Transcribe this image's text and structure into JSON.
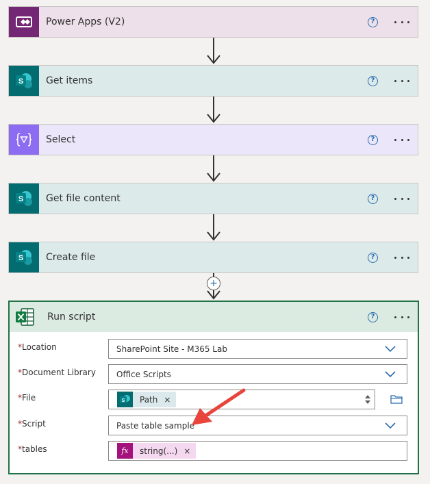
{
  "steps": [
    {
      "title": "Power Apps (V2)",
      "help": "?"
    },
    {
      "title": "Get items",
      "help": "?"
    },
    {
      "title": "Select",
      "help": "?"
    },
    {
      "title": "Get file content",
      "help": "?"
    },
    {
      "title": "Create file",
      "help": "?"
    }
  ],
  "add_step_symbol": "+",
  "run_script": {
    "title": "Run script",
    "help": "?",
    "fields": [
      {
        "label": "Location",
        "value": "SharePoint Site - M365 Lab"
      },
      {
        "label": "Document Library",
        "value": "Office Scripts"
      },
      {
        "label": "File",
        "token": "Path",
        "token_icon_text": "S"
      },
      {
        "label": "Script",
        "value": "Paste table sample"
      },
      {
        "label": "tables",
        "token": "string(...)",
        "token_icon_text": "fx"
      }
    ],
    "required_mark": "*",
    "remove_symbol": "×"
  },
  "colors": {
    "powerapps_bg": "#ede0ea",
    "powerapps_icon": "#742774",
    "sharepoint_bg": "#dceaea",
    "sharepoint_icon": "#036c70",
    "select_bg": "#ebe6f9",
    "select_icon": "#8c6cf0",
    "excel_border": "#217346",
    "excel_header": "#dcebe2",
    "fx_token": "#f4d8f0",
    "fx_icon": "#a4127d",
    "sp_token": "#dce9ec",
    "arrow": "#e8453c"
  }
}
